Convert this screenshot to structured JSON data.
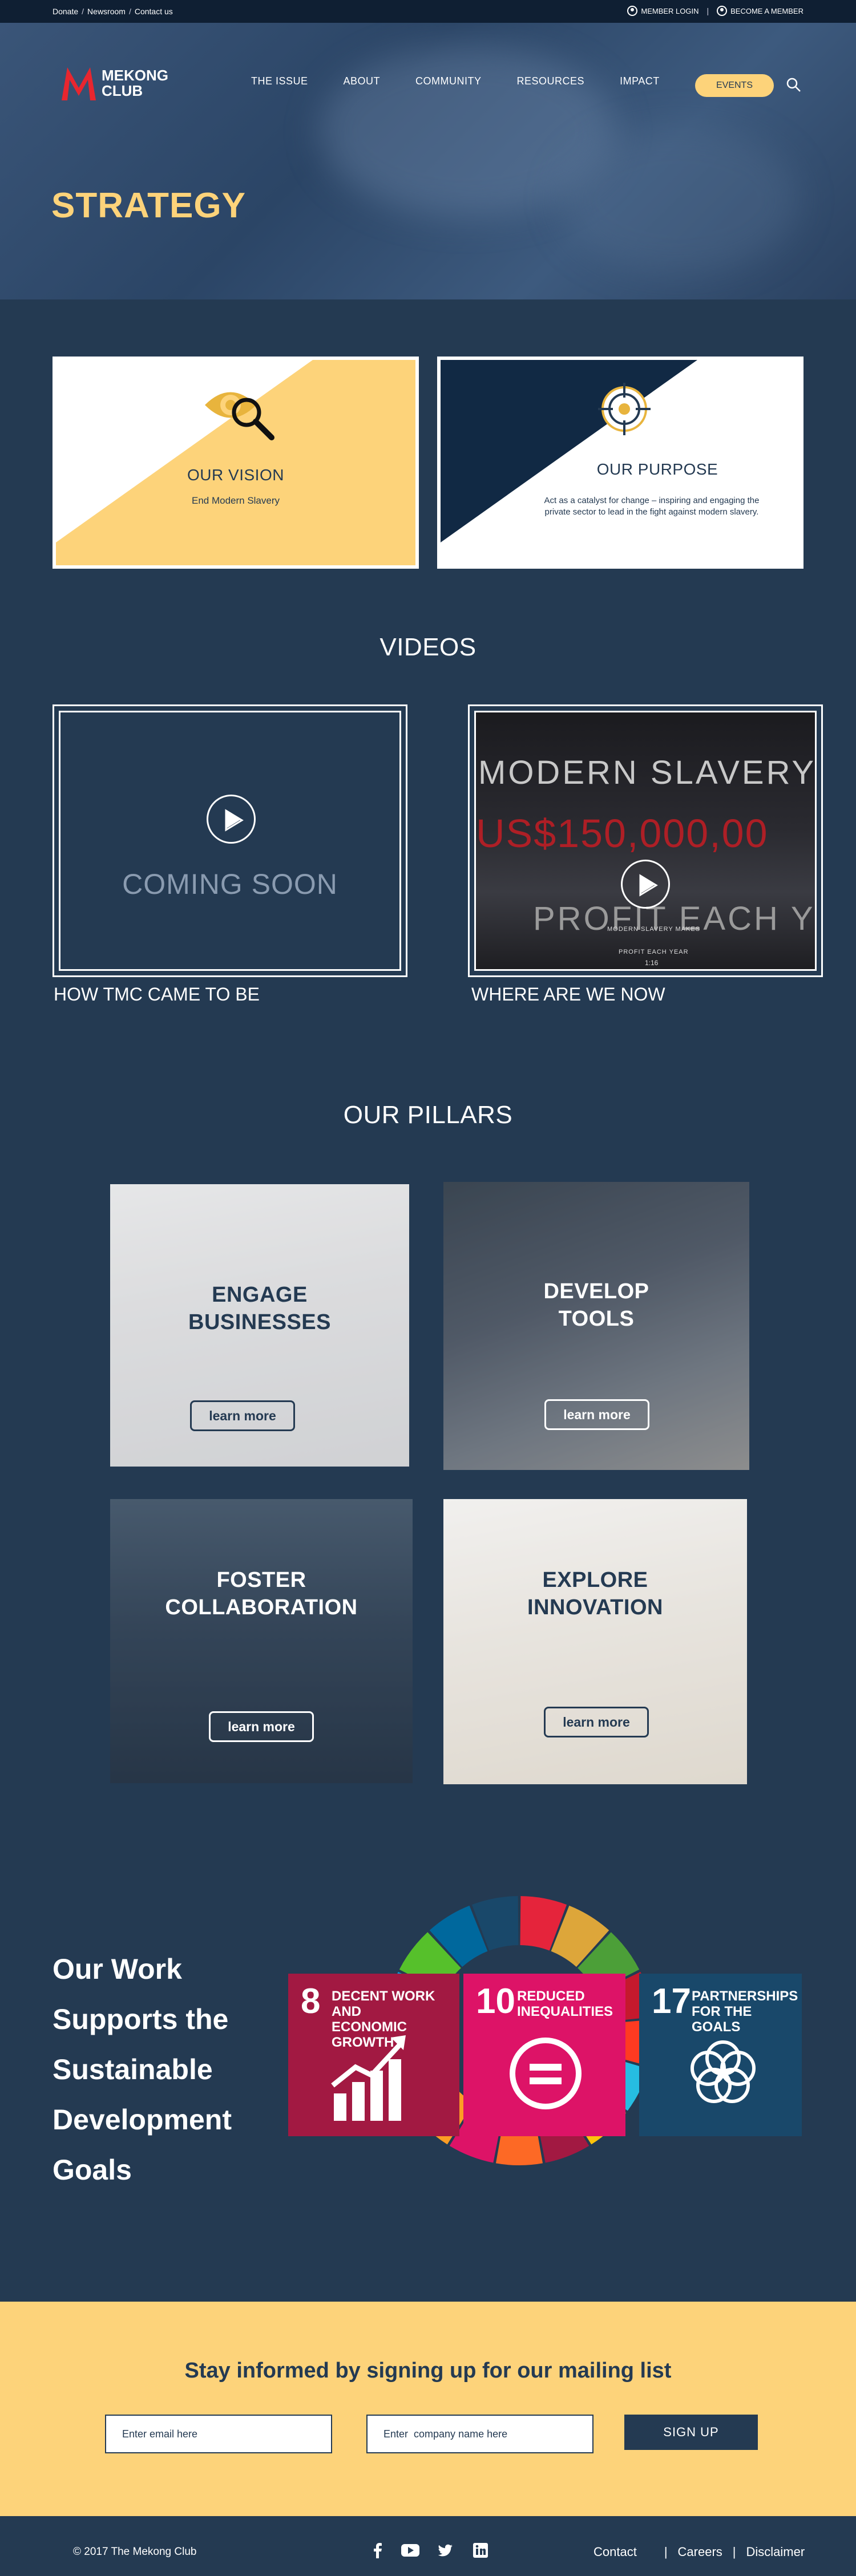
{
  "topbar": {
    "links": [
      "Donate",
      "Newsroom",
      "Contact us"
    ],
    "member_login": "MEMBER LOGIN",
    "become_member": "BECOME A MEMBER"
  },
  "brand": {
    "line1": "MEKONG",
    "line2": "CLUB"
  },
  "nav": {
    "items": [
      "THE ISSUE",
      "ABOUT",
      "COMMUNITY",
      "RESOURCES",
      "IMPACT"
    ],
    "events": "EVENTS"
  },
  "hero": {
    "title": "STRATEGY"
  },
  "vision": {
    "title": "OUR VISION",
    "text": "End Modern Slavery"
  },
  "purpose": {
    "title": "OUR PURPOSE",
    "text_line1": "Act as a catalyst for change – inspiring and engaging the",
    "text_line2": "private sector to lead in the fight against modern slavery."
  },
  "videos": {
    "heading": "VIDEOS",
    "items": [
      {
        "caption": "HOW TMC CAME TO BE",
        "overlay": "COMING SOON"
      },
      {
        "caption": "WHERE ARE WE NOW",
        "line1": "MODERN SLAVERY",
        "line2": "US$150,000,00",
        "line3": "PROFIT EACH Y",
        "small1": "MODERN SLAVERY MAKES",
        "small2": "PROFIT EACH YEAR",
        "duration": "1:16"
      }
    ]
  },
  "pillars": {
    "heading": "OUR PILLARS",
    "items": [
      {
        "line1": "ENGAGE",
        "line2": "BUSINESSES",
        "button": "learn more"
      },
      {
        "line1": "DEVELOP",
        "line2": "TOOLS",
        "button": "learn more"
      },
      {
        "line1": "FOSTER",
        "line2": "COLLABORATION",
        "button": "learn more"
      },
      {
        "line1": "EXPLORE",
        "line2": "INNOVATION",
        "button": "learn more"
      }
    ]
  },
  "sdg": {
    "title_lines": [
      "Our Work",
      "Supports the",
      "Sustainable",
      "Development",
      "Goals"
    ],
    "cards": [
      {
        "number": "8",
        "label1": "DECENT WORK AND",
        "label2": "ECONOMIC GROWTH",
        "color": "#a21942"
      },
      {
        "number": "10",
        "label1": "REDUCED",
        "label2": "INEQUALITIES",
        "color": "#dd1367"
      },
      {
        "number": "17",
        "label1": "PARTNERSHIPS",
        "label2": "FOR THE GOALS",
        "color": "#19486a"
      }
    ],
    "wheel_colors": [
      "#e5243b",
      "#dda63a",
      "#4c9f38",
      "#c5192d",
      "#ff3a21",
      "#26bde2",
      "#fcc30b",
      "#a21942",
      "#fd6925",
      "#dd1367",
      "#fd9d24",
      "#bf8b2e",
      "#3f7e44",
      "#0a97d9",
      "#56c02b",
      "#00689d",
      "#19486a"
    ]
  },
  "newsletter": {
    "heading": "Stay informed by signing up for our mailing list",
    "email_placeholder": "Enter email here",
    "company_placeholder": "Enter  company name here",
    "button": "SIGN UP"
  },
  "footer": {
    "copyright": "© 2017 The Mekong Club",
    "links": [
      "Contact",
      "Careers",
      "Disclaimer"
    ]
  },
  "colors": {
    "navy": "#243a52",
    "dark_navy": "#0f1f33",
    "yellow": "#fdd37a",
    "brand_red": "#e8262f"
  }
}
